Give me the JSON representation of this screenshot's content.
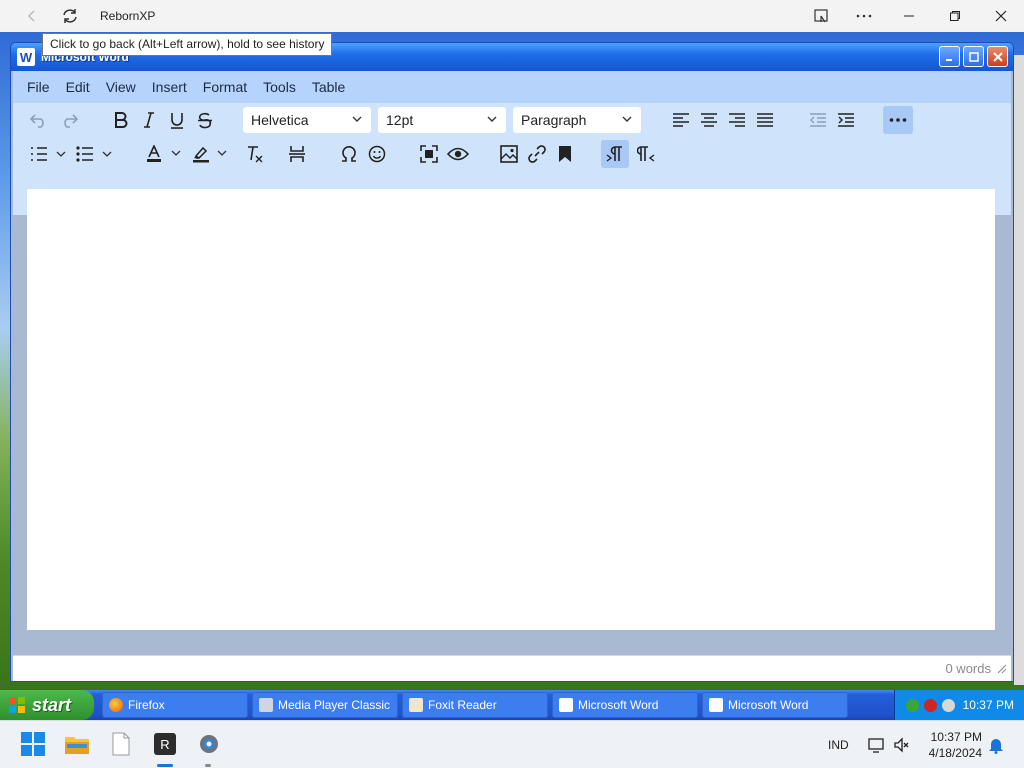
{
  "host": {
    "title": "RebornXP",
    "tooltip": "Click to go back (Alt+Left arrow), hold to see history"
  },
  "word_window": {
    "title": "Microsoft Word"
  },
  "menubar": {
    "items": [
      "File",
      "Edit",
      "View",
      "Insert",
      "Format",
      "Tools",
      "Table"
    ]
  },
  "toolbar": {
    "font_family": "Helvetica",
    "font_size": "12pt",
    "block_format": "Paragraph"
  },
  "statusbar": {
    "word_count": "0 words"
  },
  "xp_taskbar": {
    "start_label": "start",
    "tasks": [
      "Firefox",
      "Media Player Classic",
      "Foxit Reader",
      "Microsoft Word",
      "Microsoft Word"
    ],
    "tray_time": "10:37 PM"
  },
  "win_taskbar": {
    "language": "IND",
    "time": "10:37 PM",
    "date": "4/18/2024"
  },
  "colors": {
    "xp_title_blue": "#1d6ee8",
    "editor_toolbar_bg": "#cfe3fb",
    "xp_start_green": "#2f8f2f"
  }
}
